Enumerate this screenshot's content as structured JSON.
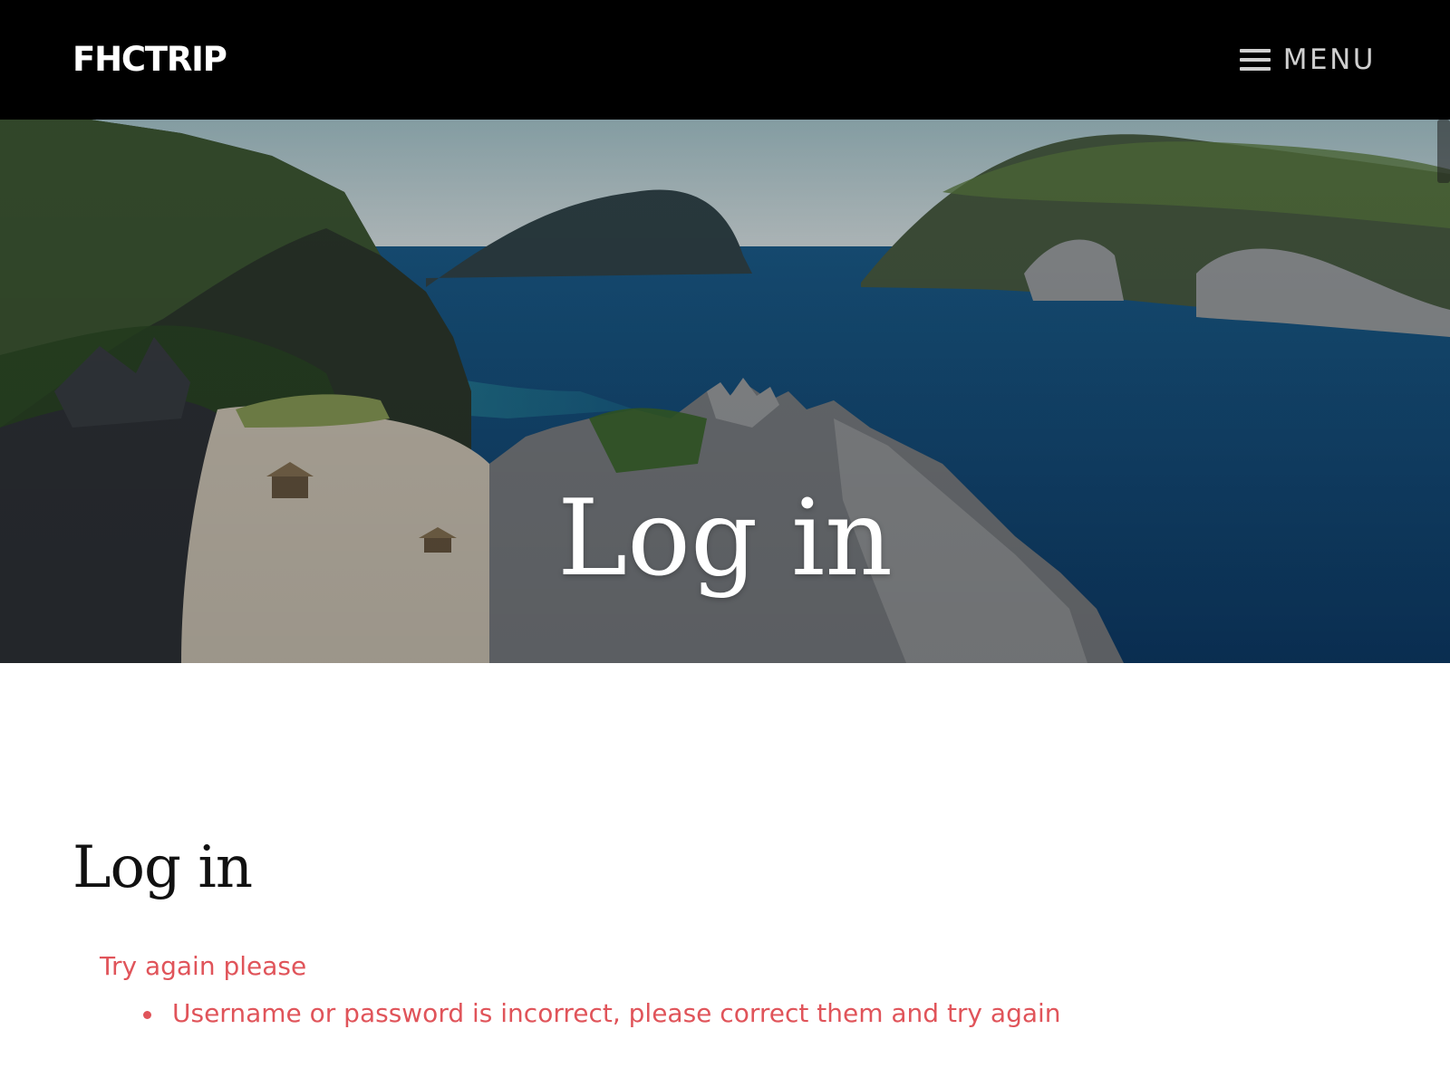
{
  "header": {
    "brand": "FHCTRIP",
    "menu_label": "MENU",
    "menu_icon": "hamburger-icon"
  },
  "hero": {
    "title": "Log in",
    "image_description_icon": "landscape-image"
  },
  "main": {
    "heading": "Log in",
    "error": {
      "title": "Try again please",
      "messages": [
        "Username or password is incorrect, please correct them and try again"
      ]
    }
  },
  "colors": {
    "header_bg": "#000000",
    "brand_text": "#ffffff",
    "menu_text": "#cfcfcf",
    "error": "#e0545a",
    "heading": "#111111"
  }
}
